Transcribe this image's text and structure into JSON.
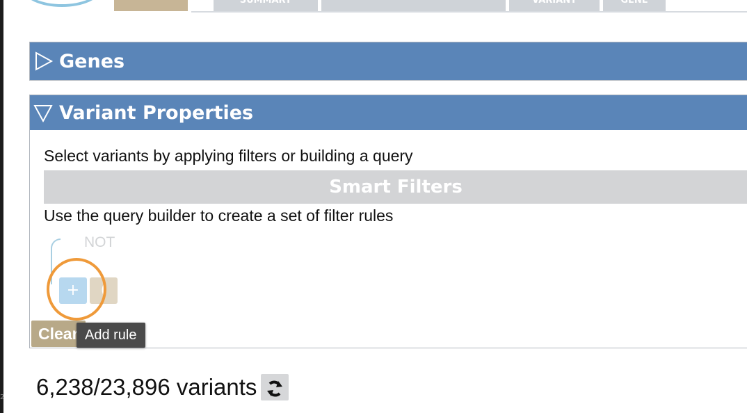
{
  "top_tabs": [
    {
      "label": "",
      "active": true
    },
    {
      "label": "SUMMARY",
      "active": false
    },
    {
      "label": "",
      "active": false
    },
    {
      "label": "VARIANT",
      "active": false
    },
    {
      "label": "GENE",
      "active": false
    }
  ],
  "panels": {
    "genes": {
      "title": "Genes",
      "expanded": false
    },
    "variant_properties": {
      "title": "Variant Properties",
      "expanded": true,
      "intro": "Select variants by applying filters or building a query",
      "smart_filters_label": "Smart Filters",
      "builder_instructions": "Use the query builder to create a set of filter rules",
      "query_builder": {
        "not_label": "NOT",
        "add_rule_symbol": "+",
        "add_group_symbol": "("
      },
      "clear_button_label": "Clear"
    }
  },
  "tooltip": {
    "text": "Add rule"
  },
  "variant_count": {
    "text": "6,238/23,896 variants"
  },
  "colors": {
    "panel_header": "#5a85b8",
    "smart_filters_bar": "#d3d4d6",
    "add_rule_button": "#b7d8ef",
    "add_group_button": "#e0d6c3",
    "clear_button": "#b8a988",
    "highlight_ring": "#ef9a3a",
    "tooltip_bg": "#4a4a4a"
  },
  "icons": {
    "collapsed": "triangle-right-icon",
    "expanded": "triangle-down-icon",
    "refresh": "refresh-icon"
  }
}
